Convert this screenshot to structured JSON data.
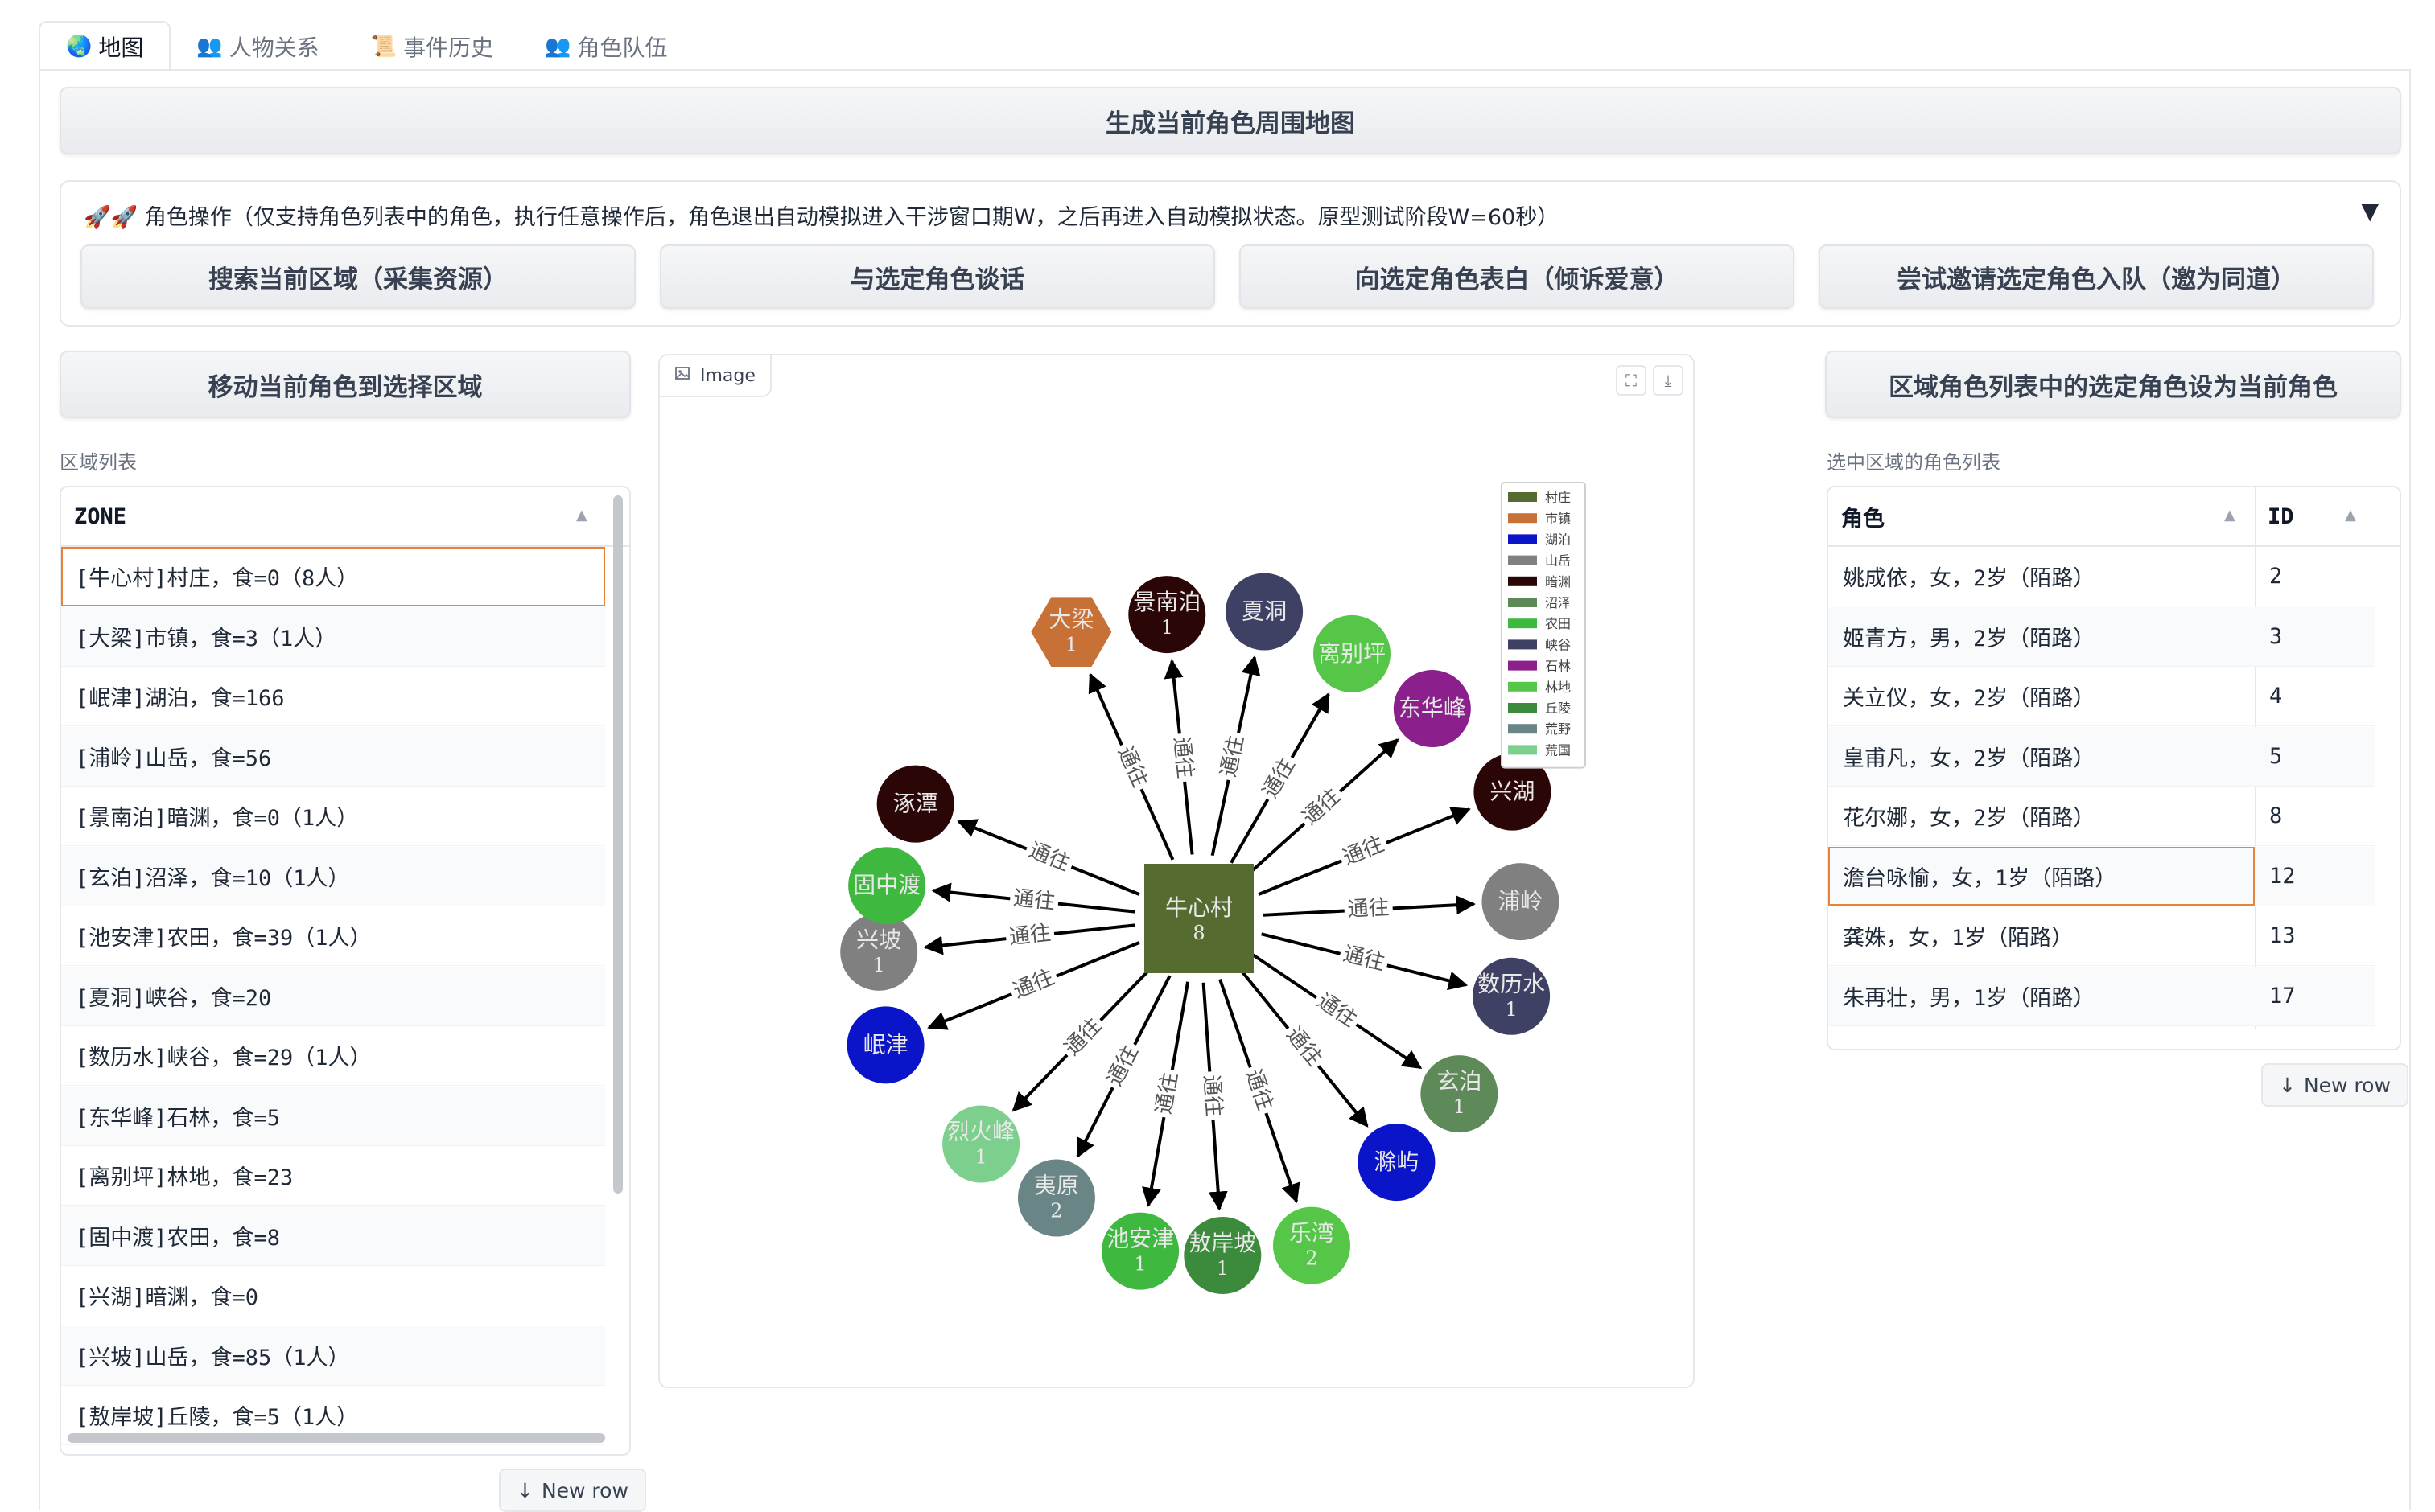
{
  "tabs": [
    {
      "icon": "🌏",
      "label": "地图",
      "active": true
    },
    {
      "icon": "👥",
      "label": "人物关系",
      "active": false
    },
    {
      "icon": "📜",
      "label": "事件历史",
      "active": false
    },
    {
      "icon": "👥",
      "label": "角色队伍",
      "active": false
    }
  ],
  "generate_map_button": "生成当前角色周围地图",
  "actions": {
    "title": "🚀🚀 角色操作（仅支持角色列表中的角色，执行任意操作后，角色退出自动模拟进入干涉窗口期W，之后再进入自动模拟状态。原型测试阶段W=60秒）",
    "caret": "▼",
    "buttons": [
      "搜索当前区域（采集资源）",
      "与选定角色谈话",
      "向选定角色表白（倾诉爱意）",
      "尝试邀请选定角色入队（邀为同道）"
    ]
  },
  "move_button": "移动当前角色到选择区域",
  "set_current_button": "区域角色列表中的选定角色设为当前角色",
  "zone_table": {
    "label": "区域列表",
    "header": "ZONE",
    "rows": [
      "[牛心村]村庄，食=0（8人）",
      "[大梁]市镇，食=3（1人）",
      "[岷津]湖泊，食=166",
      "[浦岭]山岳，食=56",
      "[景南泊]暗渊，食=0（1人）",
      "[玄泊]沼泽，食=10（1人）",
      "[池安津]农田，食=39（1人）",
      "[夏洞]峡谷，食=20",
      "[数历水]峡谷，食=29（1人）",
      "[东华峰]石林，食=5",
      "[离别坪]林地，食=23",
      "[固中渡]农田，食=8",
      "[兴湖]暗渊，食=0",
      "[兴坡]山岳，食=85（1人）",
      "[敖岸坡]丘陵，食=5（1人）"
    ],
    "new_row": "New row"
  },
  "char_table": {
    "label": "选中区域的角色列表",
    "headers": [
      "角色",
      "ID"
    ],
    "rows": [
      [
        "姚成依，女，2岁（陌路）",
        "2"
      ],
      [
        "姬青方，男，2岁（陌路）",
        "3"
      ],
      [
        "关立仪，女，2岁（陌路）",
        "4"
      ],
      [
        "皇甫凡，女，2岁（陌路）",
        "5"
      ],
      [
        "花尔娜，女，2岁（陌路）",
        "8"
      ],
      [
        "澹台咏愉，女，1岁（陌路）",
        "12"
      ],
      [
        "龚姝，女，1岁（陌路）",
        "13"
      ],
      [
        "朱再壮，男，1岁（陌路）",
        "17"
      ]
    ],
    "new_row": "New row"
  },
  "image_panel": {
    "label": "Image",
    "fullscreen_icon": "⛶",
    "download_icon": "⤓"
  },
  "map": {
    "edge_label": "通往",
    "center": {
      "name": "牛心村",
      "count": "8",
      "type": "村庄"
    },
    "nodes": [
      {
        "name": "大梁",
        "count": "1",
        "type": "市镇",
        "shape": "hexagon"
      },
      {
        "name": "景南泊",
        "count": "1",
        "type": "暗渊"
      },
      {
        "name": "夏洞",
        "count": "",
        "type": "峡谷"
      },
      {
        "name": "离别坪",
        "count": "",
        "type": "林地"
      },
      {
        "name": "东华峰",
        "count": "",
        "type": "石林"
      },
      {
        "name": "兴湖",
        "count": "",
        "type": "暗渊"
      },
      {
        "name": "浦岭",
        "count": "",
        "type": "山岳"
      },
      {
        "name": "数历水",
        "count": "1",
        "type": "峡谷"
      },
      {
        "name": "玄泊",
        "count": "1",
        "type": "沼泽"
      },
      {
        "name": "滁屿",
        "count": "",
        "type": "湖泊"
      },
      {
        "name": "乐湾",
        "count": "2",
        "type": "林地"
      },
      {
        "name": "敖岸坡",
        "count": "1",
        "type": "丘陵"
      },
      {
        "name": "池安津",
        "count": "1",
        "type": "农田"
      },
      {
        "name": "夷原",
        "count": "2",
        "type": "荒野"
      },
      {
        "name": "烈火峰",
        "count": "1",
        "type": "荒国"
      },
      {
        "name": "岷津",
        "count": "",
        "type": "湖泊"
      },
      {
        "name": "兴坡",
        "count": "1",
        "type": "山岳"
      },
      {
        "name": "固中渡",
        "count": "",
        "type": "农田"
      },
      {
        "name": "涿潭",
        "count": "",
        "type": "暗渊"
      }
    ],
    "legend": [
      {
        "label": "村庄",
        "color": "#556b2f"
      },
      {
        "label": "市镇",
        "color": "#c87137"
      },
      {
        "label": "湖泊",
        "color": "#0a14c8"
      },
      {
        "label": "山岳",
        "color": "#808080"
      },
      {
        "label": "暗渊",
        "color": "#2b0606"
      },
      {
        "label": "沼泽",
        "color": "#5e8a5a"
      },
      {
        "label": "农田",
        "color": "#3fb83f"
      },
      {
        "label": "峡谷",
        "color": "#3e4163"
      },
      {
        "label": "石林",
        "color": "#8b1f8b"
      },
      {
        "label": "林地",
        "color": "#55c648"
      },
      {
        "label": "丘陵",
        "color": "#3c8a3c"
      },
      {
        "label": "荒野",
        "color": "#6a8585"
      },
      {
        "label": "荒国",
        "color": "#7ccf8c"
      }
    ]
  }
}
